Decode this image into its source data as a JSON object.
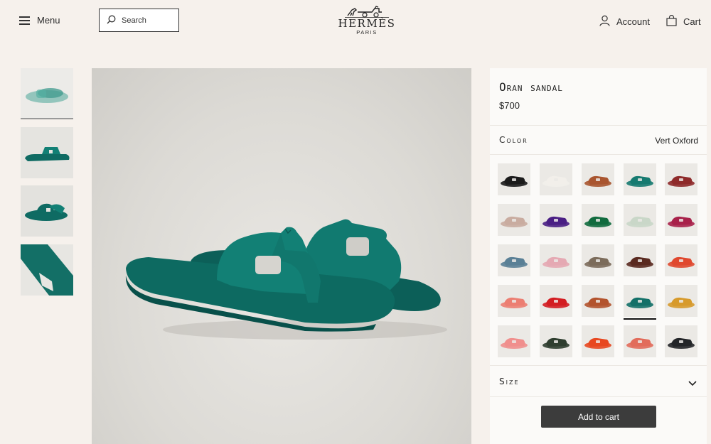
{
  "header": {
    "menu_label": "Menu",
    "search_placeholder": "Search",
    "logo_brand": "HERMÈS",
    "logo_city": "PARIS",
    "account_label": "Account",
    "cart_label": "Cart"
  },
  "gallery": {
    "thumbnails": [
      {
        "color": "#3f9a8e",
        "active": true
      },
      {
        "color": "#0f6b63",
        "active": false
      },
      {
        "color": "#0f6b63",
        "active": false
      },
      {
        "color": "#136f66",
        "active": false
      }
    ],
    "main_color": "#0f6c64"
  },
  "product": {
    "title": "Oran sandal",
    "price": "$700",
    "color_label": "Color",
    "color_value": "Vert Oxford",
    "size_label": "Size",
    "add_to_cart": "Add to cart",
    "swatches": [
      "#1b1b1b",
      "#f2efea",
      "#a9552f",
      "#167a70",
      "#8e2a2a",
      "#c9aca0",
      "#4a1f84",
      "#116b3e",
      "#c9d7c8",
      "#a8214a",
      "#5a8096",
      "#e5a9b3",
      "#7c6c5b",
      "#5a2a20",
      "#e0482e",
      "#ec7e72",
      "#d31d22",
      "#b3532d",
      "#137068",
      "#d79a2b",
      "#f08f8d",
      "#2f3e2f",
      "#e84820",
      "#e26c5b",
      "#232528"
    ],
    "selected_swatch": 18
  }
}
